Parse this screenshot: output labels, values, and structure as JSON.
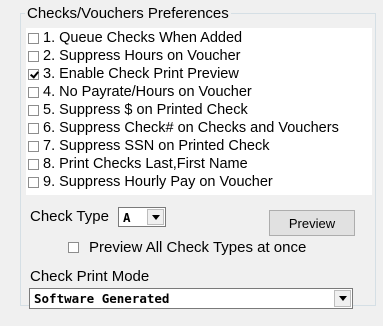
{
  "panel": {
    "title": "Checks/Vouchers Preferences"
  },
  "options": [
    {
      "label": "1. Queue Checks When Added",
      "checked": false
    },
    {
      "label": "2. Suppress Hours on Voucher",
      "checked": false
    },
    {
      "label": "3. Enable Check Print Preview",
      "checked": true
    },
    {
      "label": "4. No Payrate/Hours on Voucher",
      "checked": false
    },
    {
      "label": "5. Suppress $ on Printed Check",
      "checked": false
    },
    {
      "label": "6. Suppress Check# on Checks and Vouchers",
      "checked": false
    },
    {
      "label": "7. Suppress SSN on Printed Check",
      "checked": false
    },
    {
      "label": "8. Print Checks Last,First Name",
      "checked": false
    },
    {
      "label": "9. Suppress Hourly Pay on Voucher",
      "checked": false
    }
  ],
  "check_type": {
    "label": "Check Type",
    "value": "A"
  },
  "preview_button": {
    "label": "Preview"
  },
  "preview_all": {
    "label": "Preview All Check Types at once",
    "checked": false
  },
  "print_mode": {
    "label": "Check Print Mode",
    "value": "Software Generated"
  }
}
